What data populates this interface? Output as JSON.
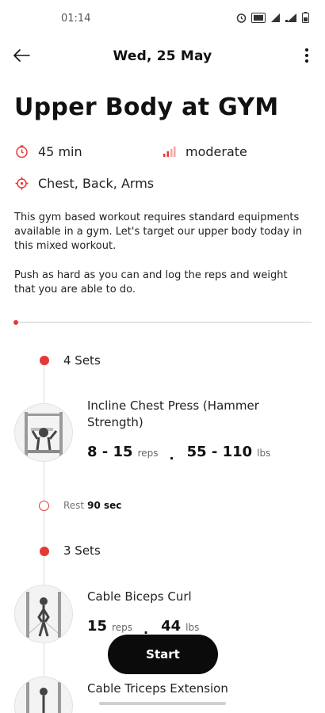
{
  "status_bar": {
    "time": "01:14",
    "icons": [
      "alarm-icon",
      "volte-icon",
      "signal-icon",
      "wifi-signal-icon",
      "battery-icon"
    ]
  },
  "header": {
    "date": "Wed, 25 May",
    "back_icon": "arrow-left-icon",
    "menu_icon": "more-vertical-icon"
  },
  "workout": {
    "title": "Upper Body at GYM",
    "duration": "45 min",
    "intensity": "moderate",
    "muscles": "Chest, Back, Arms",
    "description_1": "This gym based workout requires standard equipments available in a gym. Let's target our upper body today in this mixed workout.",
    "description_2": "Push as hard as you can and log the reps and weight that you are able to do.",
    "progress_fraction": 0.0
  },
  "blocks": [
    {
      "sets_label": "4 Sets",
      "exercise": {
        "name": "Incline Chest Press (Hammer Strength)",
        "reps": "8 - 15",
        "reps_unit": "reps",
        "weight": "55 - 110",
        "weight_unit": "lbs"
      },
      "rest": {
        "label": "Rest",
        "value": "90 sec"
      }
    },
    {
      "sets_label": "3 Sets",
      "exercise": {
        "name": "Cable Biceps Curl",
        "reps": "15",
        "reps_unit": "reps",
        "weight": "44",
        "weight_unit": "lbs"
      }
    },
    {
      "exercise": {
        "name": "Cable Triceps Extension"
      }
    }
  ],
  "start_button": "Start",
  "colors": {
    "accent": "#e53935",
    "button": "#0b0b0b"
  }
}
